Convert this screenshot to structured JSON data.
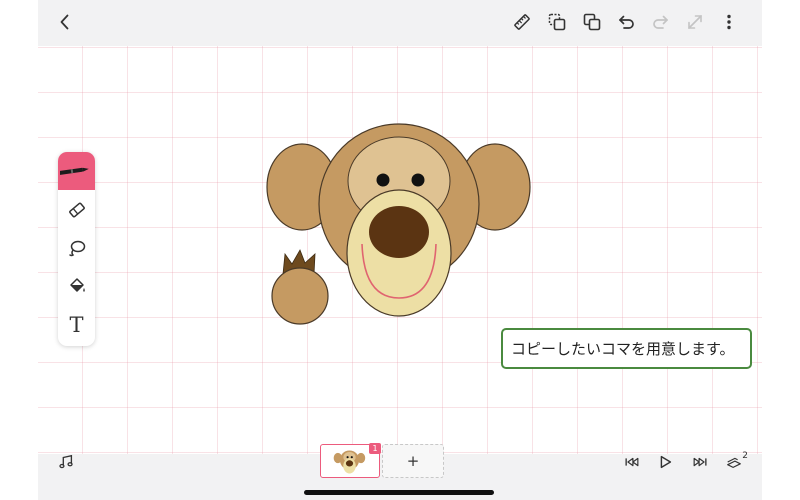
{
  "topbar": {
    "back_icon": "chevron-left-icon",
    "tools": [
      {
        "name": "ruler-icon"
      },
      {
        "name": "copy-frame-icon"
      },
      {
        "name": "duplicate-icon"
      },
      {
        "name": "undo-icon"
      },
      {
        "name": "redo-icon",
        "disabled": true
      },
      {
        "name": "transform-icon",
        "disabled": true
      },
      {
        "name": "more-icon"
      }
    ]
  },
  "toolbox": {
    "tools": [
      "pen-tool",
      "eraser-tool",
      "lasso-tool",
      "fill-tool",
      "text-tool"
    ],
    "active": "pen-tool",
    "text_tool_glyph": "T",
    "accent_color": "#ec5b7d"
  },
  "canvas": {
    "instruction_text": "コピーしたいコマを用意します。",
    "callout_border_color": "#4a8a3f"
  },
  "bottombar": {
    "music_icon": "music-note-icon",
    "current_frame_number": "1",
    "add_frame_label": "+",
    "controls": [
      "skip-to-start-icon",
      "play-icon",
      "skip-to-end-icon",
      "onion-skin-icon"
    ],
    "onion_skin_level": "2"
  }
}
